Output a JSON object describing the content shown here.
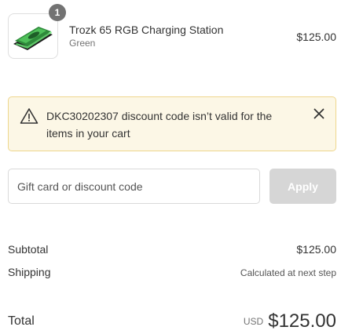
{
  "cart": {
    "item": {
      "name": "Trozk 65 RGB Charging Station",
      "variant": "Green",
      "price": "$125.00",
      "quantity": "1",
      "thumbnail_icon": "charging-station-product-image"
    }
  },
  "warning": {
    "message": "DKC30202307 discount code isn’t valid for the items in your cart",
    "icon": "warning-triangle-icon",
    "close_icon": "close-icon",
    "background_color": "#fcf7e6",
    "border_color": "#eed68c"
  },
  "discount": {
    "placeholder": "Gift card or discount code",
    "value": "",
    "apply_label": "Apply",
    "apply_color": "#d6d6d6"
  },
  "summary": {
    "subtotal_label": "Subtotal",
    "subtotal_value": "$125.00",
    "shipping_label": "Shipping",
    "shipping_value": "Calculated at next step",
    "total_label": "Total",
    "currency": "USD",
    "total_value": "$125.00"
  }
}
